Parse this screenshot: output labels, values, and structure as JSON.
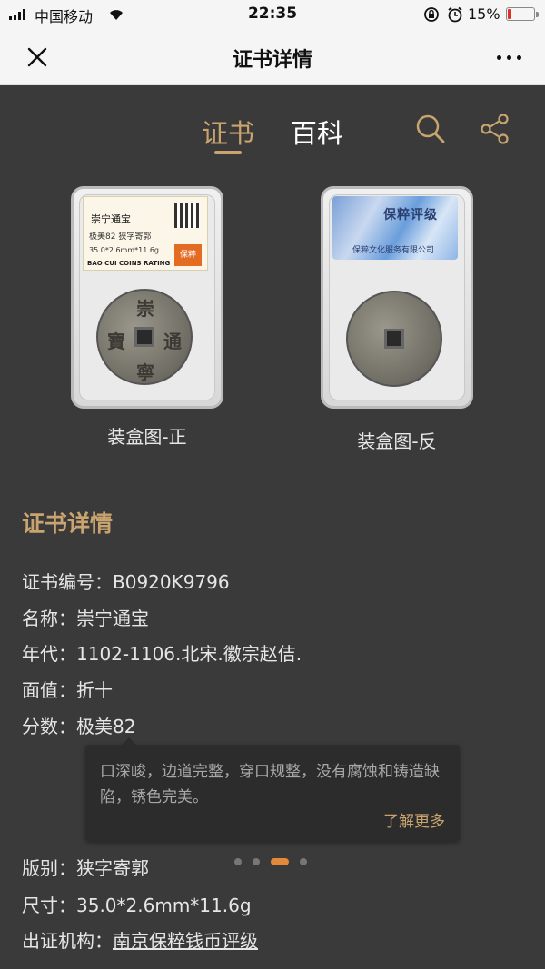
{
  "status_bar": {
    "carrier": "中国移动",
    "time": "22:35",
    "battery_percent": "15%",
    "battery_level": 0.15,
    "icons": [
      "signal-icon",
      "wifi-icon",
      "rotation-lock-icon",
      "alarm-icon",
      "battery-icon"
    ]
  },
  "nav": {
    "title": "证书详情",
    "close_icon": "close-icon",
    "more_icon": "more-icon"
  },
  "tabs": [
    {
      "label": "证书",
      "active": true
    },
    {
      "label": "百科",
      "active": false
    }
  ],
  "colors": {
    "accent": "#c9a46e",
    "background": "#3a3a3a",
    "indicator": "#e08a3a"
  },
  "slab_front": {
    "label_name": "崇宁通宝",
    "label_grade": "极美82 狭字寄郭",
    "label_size": "35.0*2.6mm*11.6g",
    "label_brand_text": "BAO CUI COINS RATING",
    "brand_mark": "保粹",
    "coin_chars": [
      "崇",
      "寧",
      "通",
      "寶"
    ],
    "caption": "装盒图-正"
  },
  "slab_back": {
    "label_title": "保粹评级",
    "label_company": "保粹文化服务有限公司",
    "caption": "装盒图-反"
  },
  "details": {
    "section_title": "证书详情",
    "cert_no_label": "证书编号：",
    "cert_no": "B0920K9796",
    "name_label": "名称：",
    "name": "崇宁通宝",
    "year_label": "年代：",
    "year": "1102-1106.北宋.徽宗赵佶.",
    "face_label": "面值：",
    "face": "折十",
    "score_label": "分数：",
    "score": "极美82",
    "variant_label": "版别：",
    "variant": "狭字寄郭",
    "size_label": "尺寸：",
    "size": "35.0*2.6mm*11.6g",
    "org_label": "出证机构：",
    "org": "南京保粹钱币评级"
  },
  "tooltip": {
    "text": "口深峻，边道完整，穿口规整，没有腐蚀和铸造缺陷，锈色完美。",
    "more": "了解更多"
  },
  "carousel": {
    "count": 4,
    "active_index": 2
  }
}
